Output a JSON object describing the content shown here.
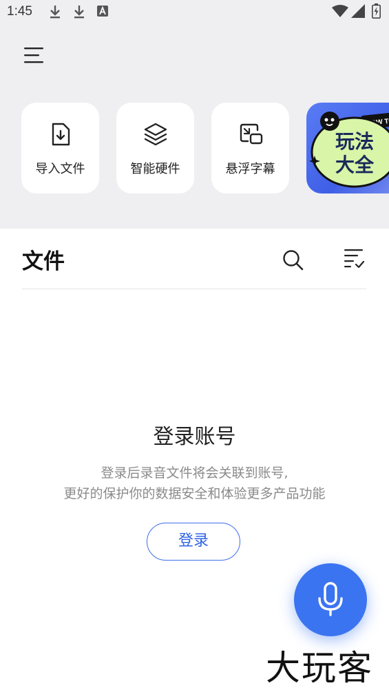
{
  "status_bar": {
    "time": "1:45",
    "left_icons": [
      "download-icon",
      "download-icon",
      "font-a-icon"
    ],
    "right_icons": [
      "wifi-icon",
      "signal-icon",
      "battery-charging-icon"
    ]
  },
  "header": {
    "menu_icon": "menu-icon"
  },
  "quick_actions": [
    {
      "label": "导入文件",
      "icon": "file-import-icon"
    },
    {
      "label": "智能硬件",
      "icon": "layers-icon"
    },
    {
      "label": "悬浮字幕",
      "icon": "picture-in-picture-icon"
    }
  ],
  "promo": {
    "title": "玩法大全",
    "tag": "HOW TO"
  },
  "files_section": {
    "title": "文件",
    "search_icon": "search-icon",
    "sort_icon": "sort-list-icon"
  },
  "login_prompt": {
    "title": "登录账号",
    "description_line1": "登录后录音文件将会关联到账号,",
    "description_line2": "更好的保护你的数据安全和体验更多产品功能",
    "button_label": "登录"
  },
  "fab": {
    "icon": "microphone-icon"
  },
  "watermark": "大玩客",
  "colors": {
    "accent": "#3a74f0",
    "top_background": "#efeff1",
    "promo_blue": "#4a6cf0",
    "promo_green": "#d8f5a8"
  }
}
